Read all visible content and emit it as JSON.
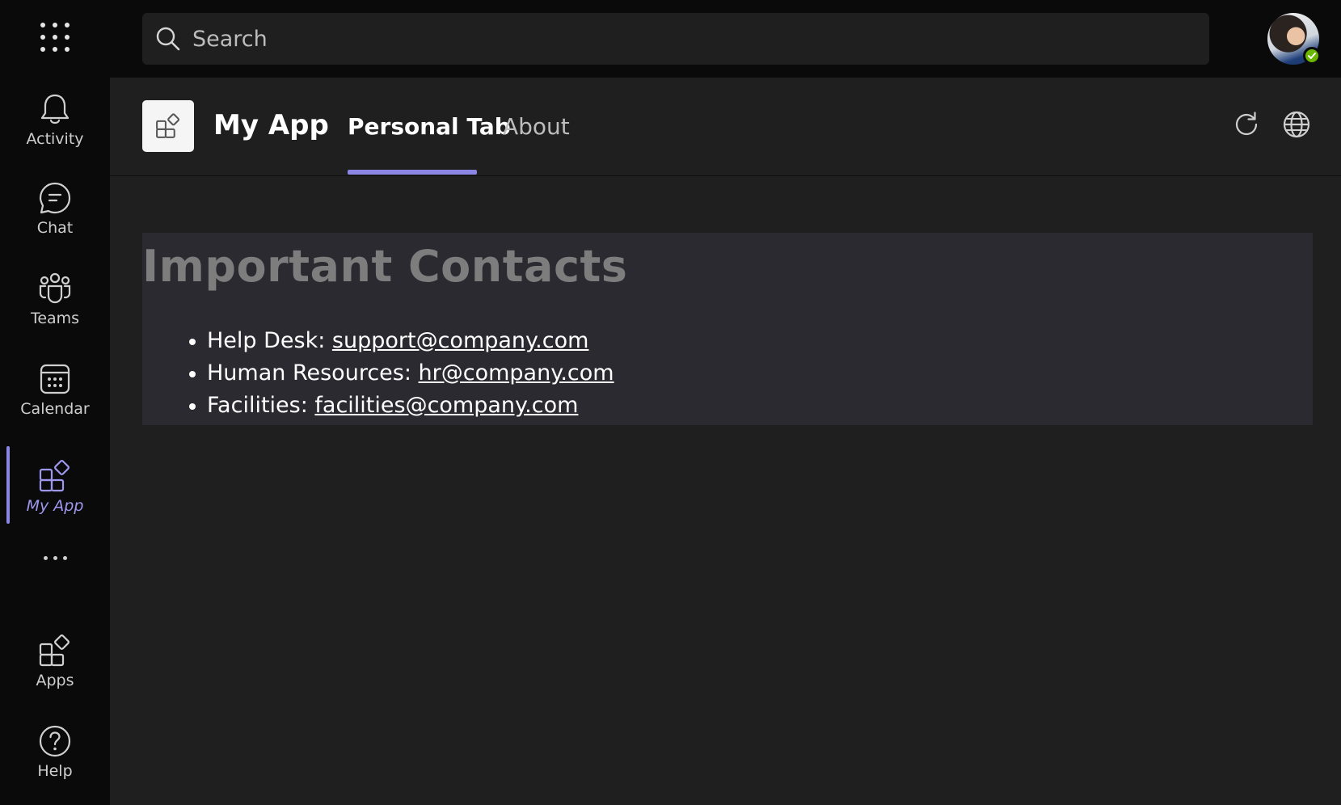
{
  "search": {
    "placeholder": "Search"
  },
  "rail": {
    "items": [
      {
        "label": "Activity",
        "icon": "bell-icon"
      },
      {
        "label": "Chat",
        "icon": "chat-icon"
      },
      {
        "label": "Teams",
        "icon": "teams-icon"
      },
      {
        "label": "Calendar",
        "icon": "calendar-icon"
      },
      {
        "label": "My App",
        "icon": "app-icon",
        "active": true
      },
      {
        "label": "Apps",
        "icon": "apps-icon"
      },
      {
        "label": "Help",
        "icon": "help-icon"
      }
    ]
  },
  "header": {
    "app_title": "My App",
    "tabs": [
      {
        "label": "Personal Tab",
        "active": true
      },
      {
        "label": "About",
        "active": false
      }
    ]
  },
  "content": {
    "heading": "Important Contacts",
    "contacts": [
      {
        "label": "Help Desk: ",
        "email": "support@company.com"
      },
      {
        "label": "Human Resources: ",
        "email": "hr@company.com"
      },
      {
        "label": "Facilities: ",
        "email": "facilities@company.com"
      }
    ]
  },
  "colors": {
    "accent": "#8b86e4",
    "presence": "#6bb700",
    "background": "#1f1f1f",
    "rail_background": "#0a0a0a",
    "content_box": "#2b2a31"
  }
}
